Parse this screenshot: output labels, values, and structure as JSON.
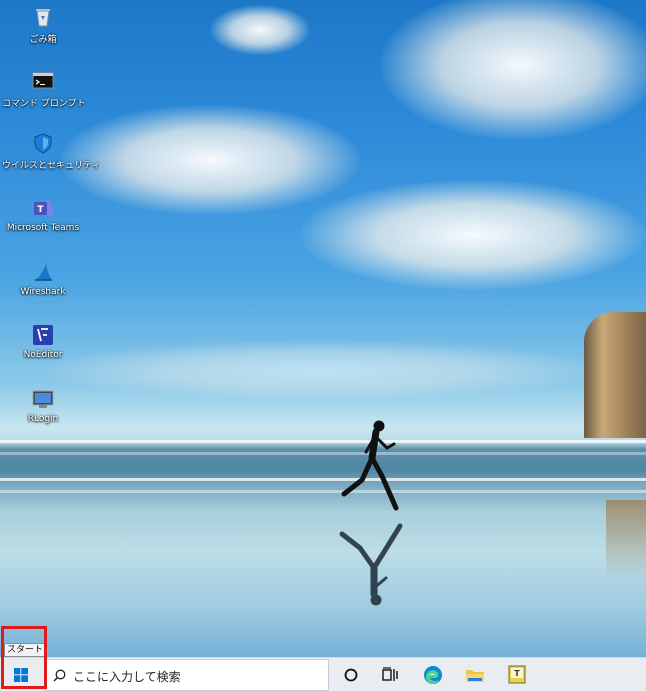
{
  "desktop": {
    "icons": [
      {
        "label": "ごみ箱",
        "icon": "recycle-bin-icon"
      },
      {
        "label": "コマンド プロンプト",
        "icon": "command-prompt-icon"
      },
      {
        "label": "ウイルスとセキュリティ",
        "icon": "security-shield-icon"
      },
      {
        "label": "Microsoft Teams",
        "icon": "teams-icon"
      },
      {
        "label": "Wireshark",
        "icon": "wireshark-fin-icon"
      },
      {
        "label": "NoEditor",
        "icon": "noeditor-icon"
      },
      {
        "label": "RLogin",
        "icon": "rlogin-icon"
      }
    ]
  },
  "taskbar": {
    "start_tooltip": "スタート",
    "search_placeholder": "ここに入力して検索",
    "pinned": [
      "cortana-circle-icon",
      "task-view-icon",
      "edge-icon",
      "file-explorer-icon",
      "notepad-app-icon"
    ]
  },
  "colors": {
    "highlight": "#e01b1b",
    "taskbar_bg": "#e9ecf0"
  }
}
